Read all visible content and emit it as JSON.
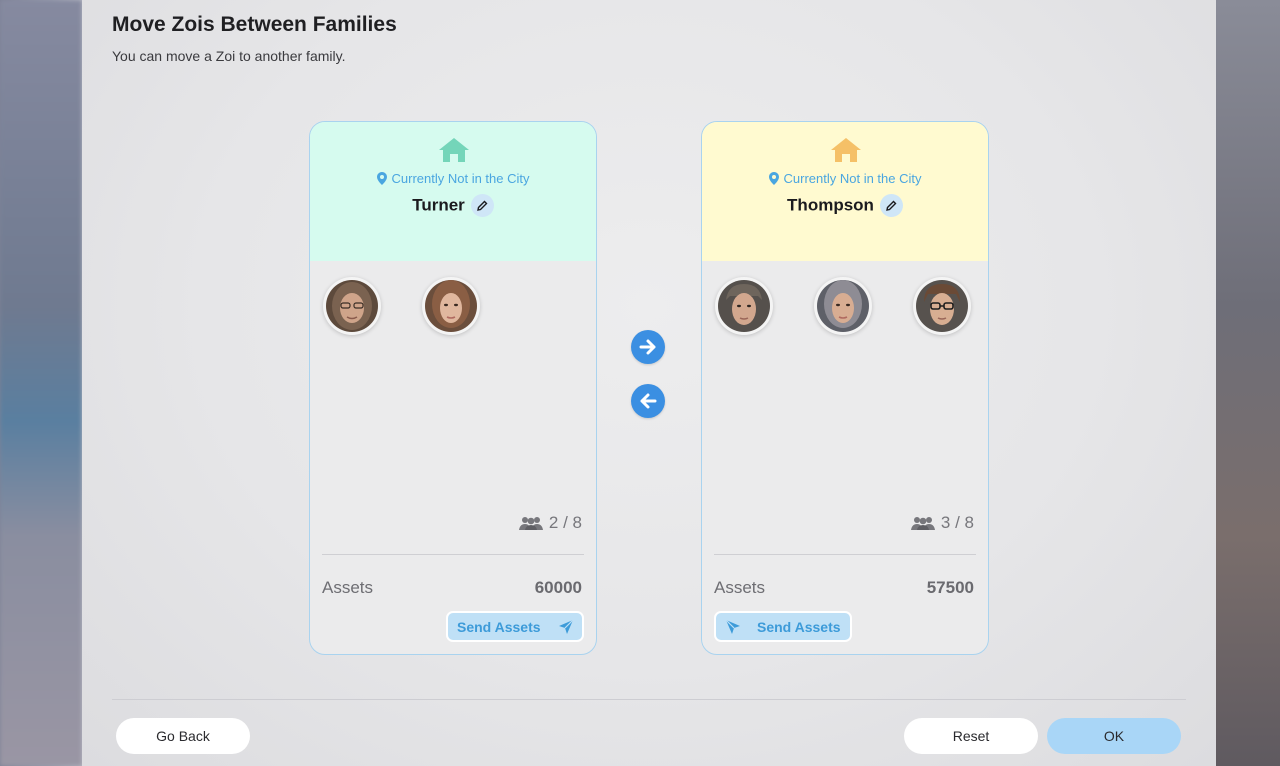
{
  "dialog": {
    "title": "Move Zois Between Families",
    "subtitle": "You can move a Zoi to another family."
  },
  "families": [
    {
      "name": "Turner",
      "location": "Currently Not in the City",
      "header_color": "#d6fbef",
      "home_icon_color": "#74d5b9",
      "members_count": "2 / 8",
      "assets_label": "Assets",
      "assets_value": "60000",
      "send_label": "Send Assets",
      "members": [
        "zoi-avatar-1",
        "zoi-avatar-2"
      ]
    },
    {
      "name": "Thompson",
      "location": "Currently Not in the City",
      "header_color": "#fffad0",
      "home_icon_color": "#f5c067",
      "members_count": "3 / 8",
      "assets_label": "Assets",
      "assets_value": "57500",
      "send_label": "Send Assets",
      "members": [
        "zoi-avatar-1",
        "zoi-avatar-2",
        "zoi-avatar-3"
      ]
    }
  ],
  "transfer": {
    "right_icon": "arrow-right-icon",
    "left_icon": "arrow-left-icon",
    "accent": "#3b8fe2"
  },
  "footer": {
    "back_label": "Go Back",
    "reset_label": "Reset",
    "ok_label": "OK",
    "ok_color": "#a9d6f7"
  }
}
